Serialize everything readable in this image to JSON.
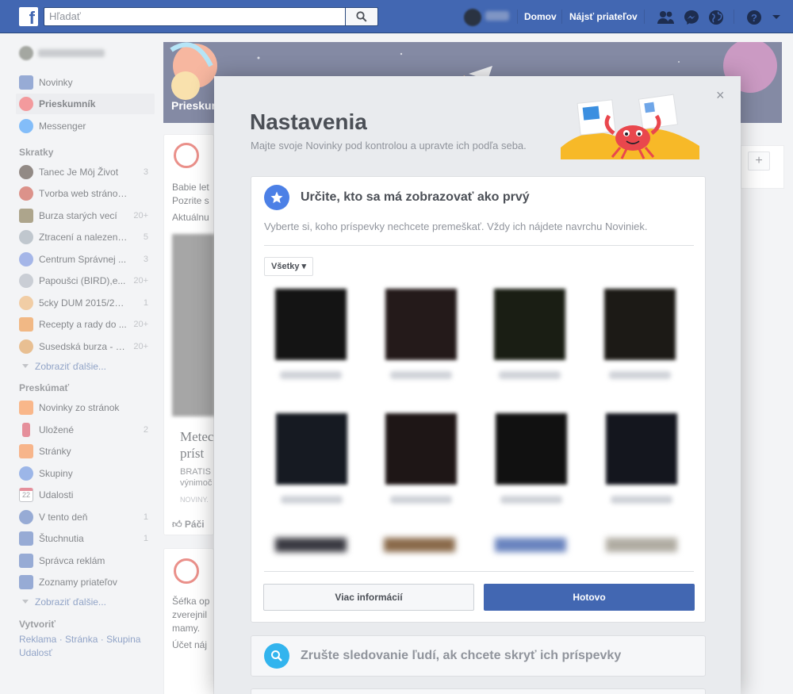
{
  "topbar": {
    "search_placeholder": "Hľadať",
    "home": "Domov",
    "find_friends": "Nájsť priateľov"
  },
  "sidebar": {
    "main": [
      {
        "label": "Novinky",
        "icon": "news-feed-icon",
        "color": "#4267b2"
      },
      {
        "label": "Prieskumník",
        "icon": "rocket-icon",
        "color": "#e9474d",
        "active": true
      },
      {
        "label": "Messenger",
        "icon": "messenger-icon",
        "color": "#1e88f5"
      }
    ],
    "shortcuts_heading": "Skratky",
    "shortcuts": [
      {
        "label": "Tanec Je Môj Život",
        "count": "3",
        "color": "#3a2a22"
      },
      {
        "label": "Tvorba web stránok ...",
        "count": "",
        "color": "#c0392b"
      },
      {
        "label": "Burza starých vecí",
        "count": "20+",
        "color": "#6b5b2e"
      },
      {
        "label": "Ztracení a nalezení ...",
        "count": "5",
        "color": "#8d99a6"
      },
      {
        "label": "Centrum Správnej ...",
        "count": "3",
        "color": "#5b7bd5"
      },
      {
        "label": "Papoušci (BIRD),e...",
        "count": "20+",
        "color": "#9ea7b3"
      },
      {
        "label": "5cky DUM 2015/2016",
        "count": "1",
        "color": "#e6a45c"
      },
      {
        "label": "Recepty a rady do ...",
        "count": "20+",
        "color": "#e67e22"
      },
      {
        "label": "Susedská burza - Z...",
        "count": "20+",
        "color": "#d68b3a"
      }
    ],
    "shortcuts_more": "Zobraziť ďalšie...",
    "explore_heading": "Preskúmať",
    "explore": [
      {
        "label": "Novinky zo stránok",
        "count": "",
        "color": "#f57d2b"
      },
      {
        "label": "Uložené",
        "count": "2",
        "color": "#d0344a"
      },
      {
        "label": "Stránky",
        "count": "",
        "color": "#f0782c"
      },
      {
        "label": "Skupiny",
        "count": "",
        "color": "#4b7bd6"
      },
      {
        "label": "Udalosti",
        "count": "",
        "color": "#e9ebee"
      },
      {
        "label": "V tento deň",
        "count": "1",
        "color": "#4267b2"
      },
      {
        "label": "Štuchnutia",
        "count": "1",
        "color": "#4267b2"
      },
      {
        "label": "Správca reklám",
        "count": "",
        "color": "#4267b2"
      },
      {
        "label": "Zoznamy priateľov",
        "count": "",
        "color": "#4267b2"
      }
    ],
    "explore_more": "Zobraziť ďalšie...",
    "events_day": "22",
    "create_heading": "Vytvoriť",
    "create_links": [
      "Reklama",
      "Stránka",
      "Skupina",
      "Udalosť"
    ]
  },
  "background": {
    "banner_label": "Prieskumník",
    "post1_lines": [
      "Babie let",
      "Pozrite s",
      "Aktuálnu"
    ],
    "post1_news_title": [
      "Metec",
      "príst"
    ],
    "post1_news_body": [
      "BRATIS",
      "výnimoč"
    ],
    "post1_source": "NOVINY.",
    "post1_like": "Páči",
    "post2_lines": [
      "Šéfka op",
      "zverejnil",
      "mamy.",
      "Účet náj"
    ]
  },
  "modal": {
    "title": "Nastavenia",
    "subtitle": "Majte svoje Novinky pod kontrolou a upravte ich podľa seba.",
    "close": "×",
    "section1": {
      "title": "Určite, kto sa má zobrazovať ako prvý",
      "description": "Vyberte si, koho príspevky nechcete premeškať. Vždy ich nájdete navrchu Noviniek.",
      "filter": "Všetky ▾",
      "more_button": "Viac informácií",
      "done_button": "Hotovo"
    },
    "section2": {
      "title": "Zrušte sledovanie ľudí, ak chcete skryť ich príspevky"
    }
  },
  "colors": {
    "brand": "#4267b2",
    "accent_star": "#4c80e6",
    "accent_search": "#32b4ee"
  }
}
